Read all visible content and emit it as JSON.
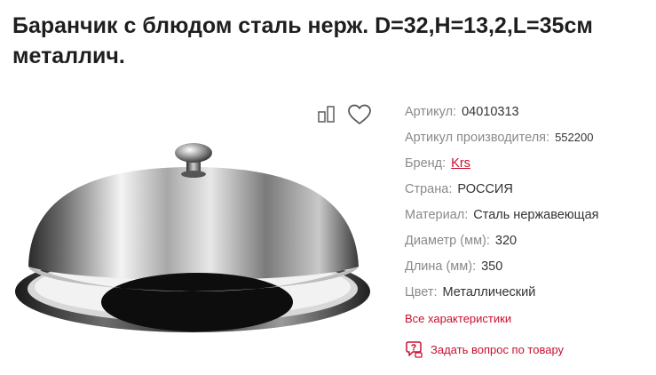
{
  "product": {
    "title": "Баранчик с блюдом сталь нерж. D=32,H=13,2,L=35см металлич."
  },
  "actions": {
    "compare_icon": "compare-icon",
    "favorite_icon": "heart-icon"
  },
  "specs": [
    {
      "label": "Артикул:",
      "value": "04010313"
    },
    {
      "label": "Артикул производителя:",
      "value": "552200"
    },
    {
      "label": "Бренд:",
      "value": "Krs"
    },
    {
      "label": "Страна:",
      "value": "РОССИЯ"
    },
    {
      "label": "Материал:",
      "value": "Сталь нержавеющая"
    },
    {
      "label": "Диаметр (мм):",
      "value": "320"
    },
    {
      "label": "Длина (мм):",
      "value": "350"
    },
    {
      "label": "Цвет:",
      "value": "Металлический"
    }
  ],
  "links": {
    "all_specs": "Все характеристики",
    "ask_question": "Задать вопрос по товару"
  },
  "colors": {
    "accent": "#c8102e",
    "label": "#8a8a8a",
    "text": "#333333"
  }
}
